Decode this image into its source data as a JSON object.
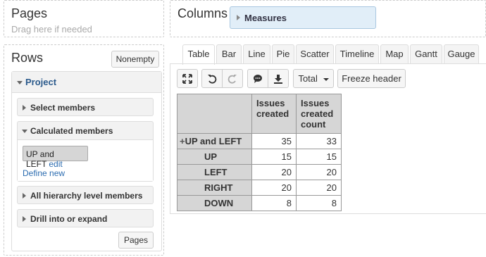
{
  "pages": {
    "title": "Pages",
    "hint": "Drag here if needed"
  },
  "columns": {
    "title": "Columns",
    "measures_label": "Measures"
  },
  "rows": {
    "title": "Rows",
    "nonempty_label": "Nonempty",
    "dimension": "Project",
    "sections": {
      "select_members": "Select members",
      "calculated_members": "Calculated members",
      "all_hierarchy": "All hierarchy level members",
      "drill": "Drill into or expand"
    },
    "calc_member_name": "UP and LEFT",
    "calc_member_edit": "edit",
    "define_new": "Define new",
    "pages_button": "Pages"
  },
  "tabs": [
    "Table",
    "Bar",
    "Line",
    "Pie",
    "Scatter",
    "Timeline",
    "Map",
    "Gantt",
    "Gauge"
  ],
  "active_tab": "Table",
  "toolbar": {
    "expand_icon": "expand-icon",
    "undo_icon": "undo-icon",
    "redo_icon": "redo-icon",
    "comment_icon": "comment-icon",
    "download_icon": "download-icon",
    "total_label": "Total",
    "freeze_label": "Freeze header"
  },
  "table": {
    "headers": [
      "Issues created",
      "Issues created count"
    ],
    "rows": [
      {
        "label": "UP and LEFT",
        "expand": "+",
        "values": [
          "35",
          "33"
        ]
      },
      {
        "label": "UP",
        "values": [
          "15",
          "15"
        ]
      },
      {
        "label": "LEFT",
        "values": [
          "20",
          "20"
        ]
      },
      {
        "label": "RIGHT",
        "values": [
          "20",
          "20"
        ]
      },
      {
        "label": "DOWN",
        "values": [
          "8",
          "8"
        ]
      }
    ]
  }
}
